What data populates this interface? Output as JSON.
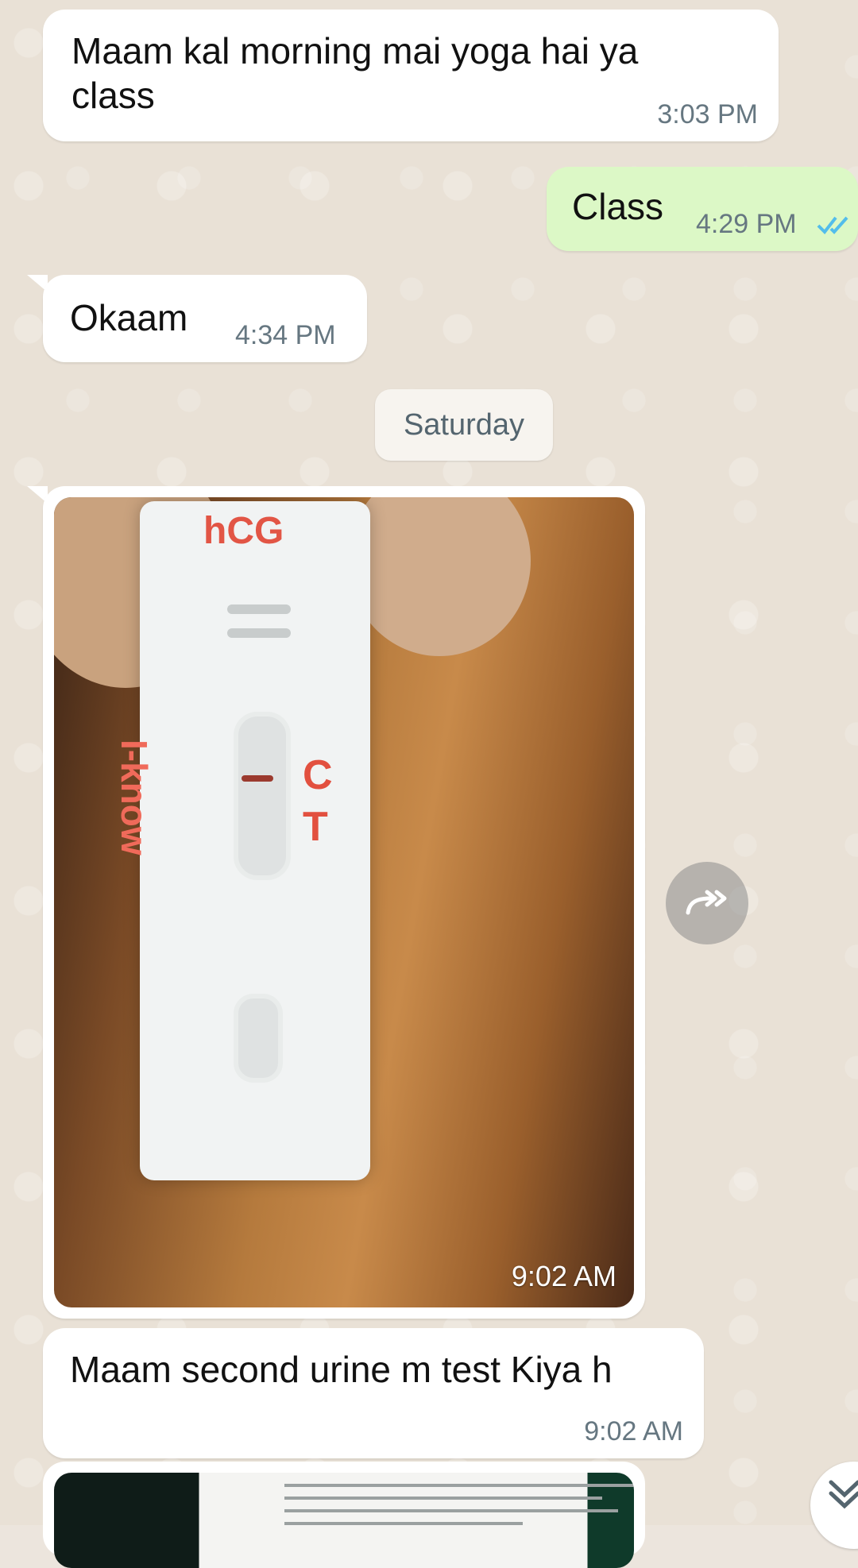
{
  "messages": [
    {
      "text": "Maam kal morning mai yoga hai ya class",
      "time": "3:03 PM"
    },
    {
      "text": "Class",
      "time": "4:29 PM"
    },
    {
      "text": "Okaam",
      "time": "4:34 PM"
    },
    {
      "text": "Maam second urine m test Kiya h",
      "time": "9:02 AM"
    }
  ],
  "date_divider": "Saturday",
  "photo": {
    "time": "9:02 AM",
    "strip_brand": "I-know",
    "strip_title": "hCG",
    "strip_c": "C",
    "strip_t": "T"
  },
  "icons": {
    "read_receipt": "double-check-icon",
    "forward": "forward-icon",
    "scroll_down": "chevron-down-double-icon"
  },
  "colors": {
    "incoming": "#ffffff",
    "outgoing": "#dcf8c6",
    "read_tick": "#53bdeb"
  }
}
